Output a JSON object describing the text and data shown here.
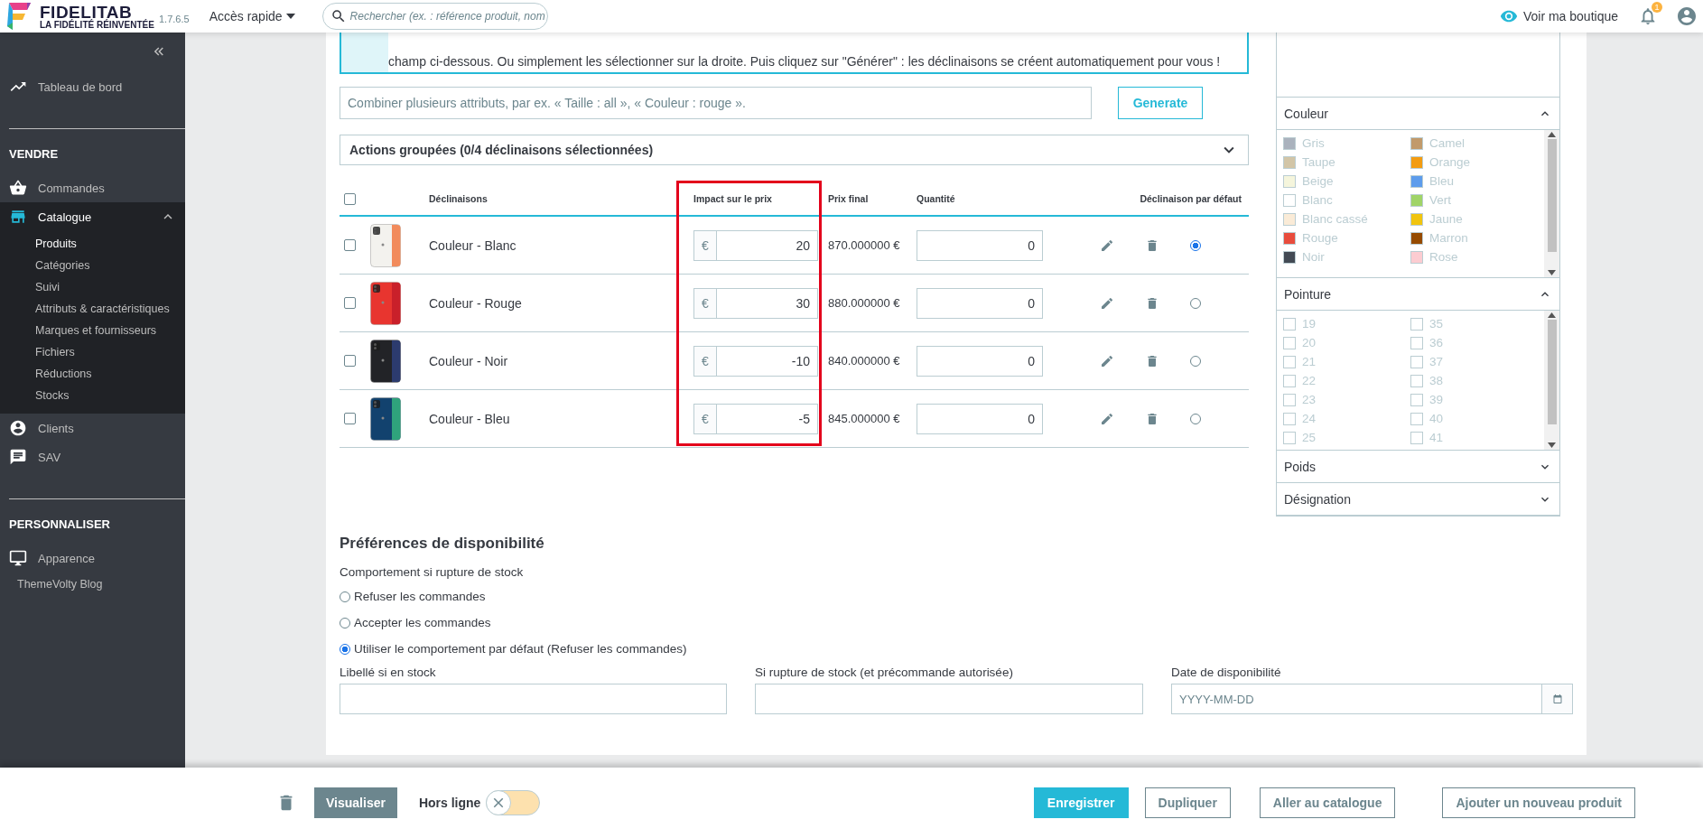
{
  "header": {
    "brand": "FIDELITAB",
    "tagline": "LA FIDÉLITÉ RÉINVENTÉE",
    "version": "1.7.6.5",
    "quick_access": "Accès rapide",
    "search": {
      "placeholder": "Rechercher (ex. : référence produit, nom"
    },
    "shop_link": "Voir ma boutique",
    "notifications": "1"
  },
  "sidebar": {
    "items": [
      {
        "kind": "link",
        "label": "Tableau de bord",
        "selected": false
      },
      {
        "kind": "heading",
        "label": "VENDRE"
      },
      {
        "kind": "link",
        "label": "Commandes",
        "selected": false
      },
      {
        "kind": "link",
        "label": "Catalogue",
        "selected": true,
        "expanded": true,
        "children": [
          {
            "label": "Produits",
            "selected": true
          },
          {
            "label": "Catégories",
            "selected": false
          },
          {
            "label": "Suivi",
            "selected": false
          },
          {
            "label": "Attributs & caractéristiques",
            "selected": false
          },
          {
            "label": "Marques et fournisseurs",
            "selected": false
          },
          {
            "label": "Fichiers",
            "selected": false
          },
          {
            "label": "Réductions",
            "selected": false
          },
          {
            "label": "Stocks",
            "selected": false
          }
        ]
      },
      {
        "kind": "link",
        "label": "Clients",
        "selected": false
      },
      {
        "kind": "link",
        "label": "SAV",
        "selected": false
      },
      {
        "kind": "heading",
        "label": "PERSONNALISER"
      },
      {
        "kind": "link",
        "label": "Apparence",
        "selected": false
      },
      {
        "kind": "plain",
        "label": "ThemeVolty Blog",
        "selected": false
      }
    ]
  },
  "info": {
    "text": "champ ci-dessous. Ou simplement les sélectionner sur la droite. Puis cliquez sur \"Générer\" : les déclinaisons se créent automatiquement pour vous !"
  },
  "combinator": {
    "placeholder": "Combiner plusieurs attributs, par ex. « Taille : all », « Couleur : rouge ».",
    "button": "Generate"
  },
  "bulk_actions": {
    "label": "Actions groupées (0/4 déclinaisons sélectionnées)",
    "expanded": false
  },
  "table": {
    "select_all": false,
    "columns": [
      "Déclinaisons",
      "Impact sur le prix",
      "Prix final",
      "Quantité",
      "Déclinaison par défaut"
    ],
    "rows": [
      {
        "selected": false,
        "name": "Couleur - Blanc",
        "currency": "€",
        "impact": "20",
        "final_price": "870.000000 €",
        "quantity": "0",
        "default": true
      },
      {
        "selected": false,
        "name": "Couleur - Rouge",
        "currency": "€",
        "impact": "30",
        "final_price": "880.000000 €",
        "quantity": "0",
        "default": false
      },
      {
        "selected": false,
        "name": "Couleur - Noir",
        "currency": "€",
        "impact": "-10",
        "final_price": "840.000000 €",
        "quantity": "0",
        "default": false
      },
      {
        "selected": false,
        "name": "Couleur - Bleu",
        "currency": "€",
        "impact": "-5",
        "final_price": "845.000000 €",
        "quantity": "0",
        "default": false
      }
    ]
  },
  "attributes_panel": {
    "groups": [
      {
        "title": "Couleur",
        "expanded": true,
        "kind": "color",
        "options": [
          {
            "label": "Gris",
            "color": "#aab2bd"
          },
          {
            "label": "Taupe",
            "color": "#d2c5a7"
          },
          {
            "label": "Beige",
            "color": "#f5f5dc"
          },
          {
            "label": "Blanc",
            "color": "#ffffff"
          },
          {
            "label": "Blanc cassé",
            "color": "#faebd7"
          },
          {
            "label": "Rouge",
            "color": "#e84c3d"
          },
          {
            "label": "Noir",
            "color": "#434a54"
          },
          {
            "label": "Camel",
            "color": "#c19a6b"
          },
          {
            "label": "Orange",
            "color": "#f39c11"
          },
          {
            "label": "Bleu",
            "color": "#5d9cec"
          },
          {
            "label": "Vert",
            "color": "#a0d468"
          },
          {
            "label": "Jaune",
            "color": "#f1c40f"
          },
          {
            "label": "Marron",
            "color": "#964b00"
          },
          {
            "label": "Rose",
            "color": "#fcccd1"
          }
        ]
      },
      {
        "title": "Pointure",
        "expanded": true,
        "kind": "checkbox",
        "options": [
          {
            "label": "19",
            "checked": false
          },
          {
            "label": "20",
            "checked": false
          },
          {
            "label": "21",
            "checked": false
          },
          {
            "label": "22",
            "checked": false
          },
          {
            "label": "23",
            "checked": false
          },
          {
            "label": "24",
            "checked": false
          },
          {
            "label": "25",
            "checked": false
          },
          {
            "label": "35",
            "checked": false
          },
          {
            "label": "36",
            "checked": false
          },
          {
            "label": "37",
            "checked": false
          },
          {
            "label": "38",
            "checked": false
          },
          {
            "label": "39",
            "checked": false
          },
          {
            "label": "40",
            "checked": false
          },
          {
            "label": "41",
            "checked": false
          }
        ]
      },
      {
        "title": "Poids",
        "expanded": false
      },
      {
        "title": "Désignation",
        "expanded": false
      }
    ]
  },
  "availability": {
    "title": "Préférences de disponibilité",
    "behavior_label": "Comportement si rupture de stock",
    "options": [
      {
        "label": "Refuser les commandes",
        "selected": false
      },
      {
        "label": "Accepter les commandes",
        "selected": false
      },
      {
        "label": "Utiliser le comportement par défaut (Refuser les commandes)",
        "selected": true
      }
    ],
    "fields": [
      {
        "kind": "text",
        "label": "Libellé si en stock"
      },
      {
        "kind": "text",
        "label": "Si rupture de stock (et précommande autorisée)"
      },
      {
        "kind": "date",
        "label": "Date de disponibilité",
        "placeholder": "YYYY-MM-DD"
      }
    ]
  },
  "footer": {
    "preview": "Visualiser",
    "online_label": "Hors ligne",
    "online": false,
    "buttons": [
      {
        "kind": "primary",
        "label": "Enregistrer"
      },
      {
        "kind": "outline",
        "label": "Dupliquer"
      },
      {
        "kind": "outline",
        "label": "Aller au catalogue"
      },
      {
        "kind": "outline",
        "label": "Ajouter un nouveau produit"
      }
    ]
  }
}
